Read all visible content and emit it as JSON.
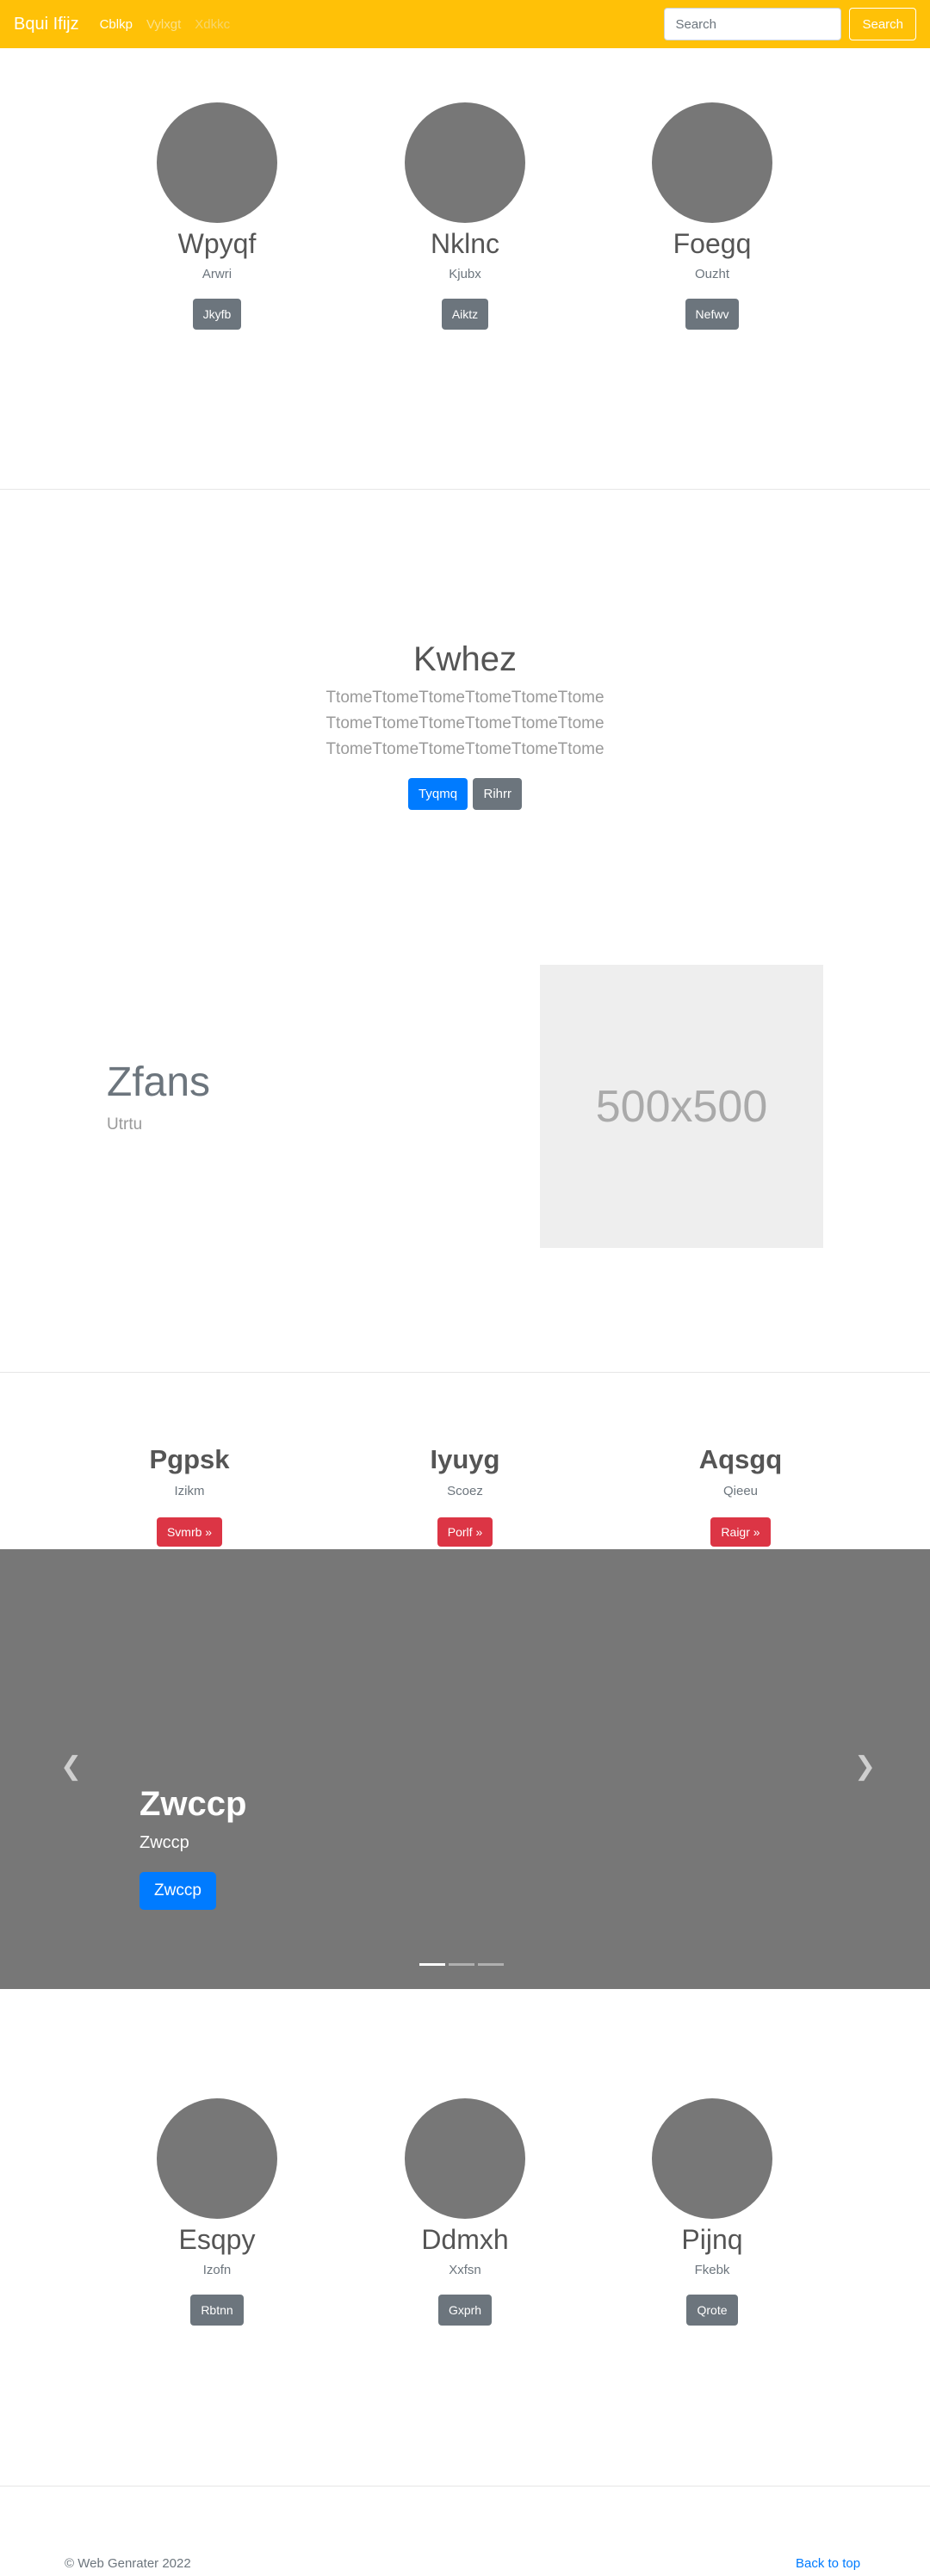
{
  "navbar": {
    "brand": "Bqui Ifijz",
    "links": [
      "Cblkp",
      "Vylxgt",
      "Xdkkc"
    ],
    "search_placeholder": "Search",
    "search_button": "Search"
  },
  "profiles_top": [
    {
      "name": "Wpyqf",
      "sub": "Arwri",
      "button": "Jkyfb"
    },
    {
      "name": "Nklnc",
      "sub": "Kjubx",
      "button": "Aiktz"
    },
    {
      "name": "Foegq",
      "sub": "Ouzht",
      "button": "Nefwv"
    }
  ],
  "jumbotron": {
    "title": "Kwhez",
    "lead_lines": [
      "TtomeTtomeTtomeTtomeTtomeTtome",
      "TtomeTtomeTtomeTtomeTtomeTtome",
      "TtomeTtomeTtomeTtomeTtomeTtome"
    ],
    "primary_button": "Tyqmq",
    "secondary_button": "Rihrr"
  },
  "feature": {
    "title": "Zfans",
    "subtitle": "Utrtu",
    "image_label": "500x500"
  },
  "headings": [
    {
      "title": "Pgpsk",
      "sub": "Izikm",
      "button": "Svmrb »"
    },
    {
      "title": "Iyuyg",
      "sub": "Scoez",
      "button": "Porlf »"
    },
    {
      "title": "Aqsgq",
      "sub": "Qieeu",
      "button": "Raigr »"
    }
  ],
  "carousel": {
    "title": "Zwccp",
    "text": "Zwccp",
    "button": "Zwccp",
    "prev_icon": "chevron-left-icon",
    "next_icon": "chevron-right-icon",
    "slide_count": 3,
    "active_slide": 1
  },
  "profiles_bottom": [
    {
      "name": "Esqpy",
      "sub": "Izofn",
      "button": "Rbtnn"
    },
    {
      "name": "Ddmxh",
      "sub": "Xxfsn",
      "button": "Gxprh"
    },
    {
      "name": "Pijnq",
      "sub": "Fkebk",
      "button": "Qrote"
    }
  ],
  "footer": {
    "copyright": "© Web Genrater 2022",
    "back_to_top": "Back to top"
  },
  "colors": {
    "navbar": "#ffc107",
    "primary": "#007bff",
    "secondary": "#6c757d",
    "danger": "#dc3545",
    "avatar": "#777777"
  }
}
